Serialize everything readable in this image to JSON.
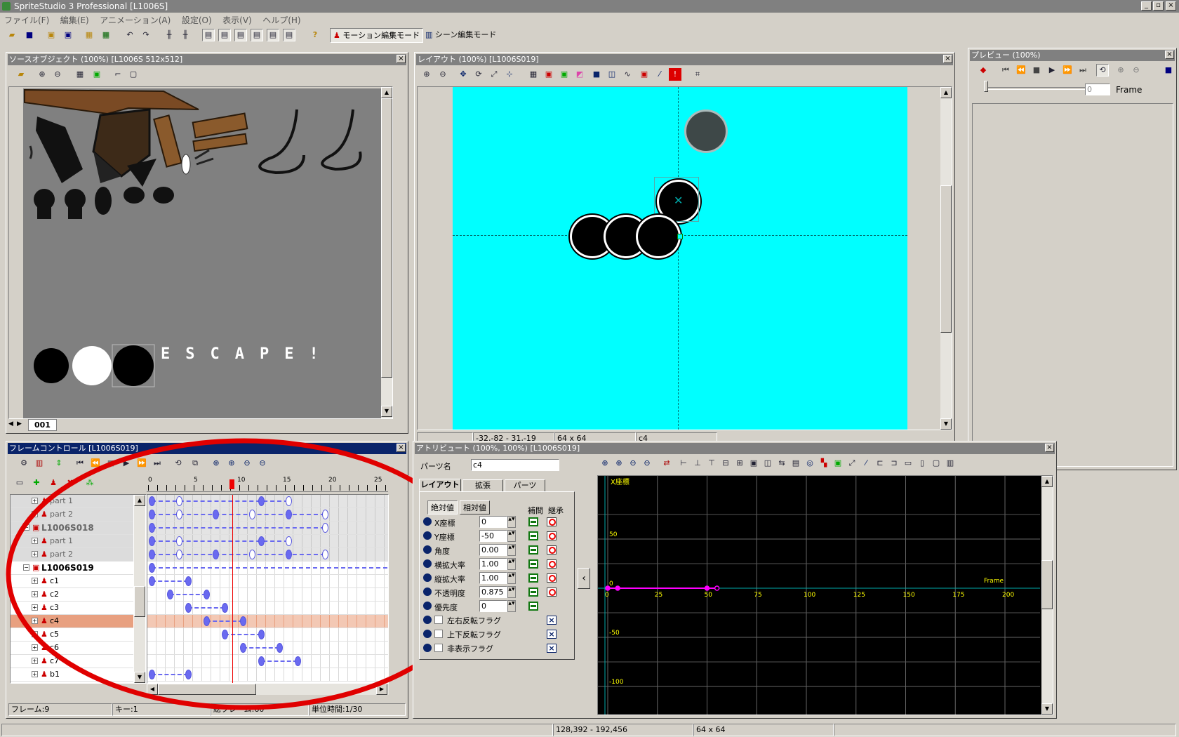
{
  "app": {
    "title": "SpriteStudio 3 Professional [L1006S]",
    "menus": [
      "ファイル(F)",
      "編集(E)",
      "アニメーション(A)",
      "設定(O)",
      "表示(V)",
      "ヘルプ(H)"
    ],
    "modes": {
      "motion": "モーション編集モード",
      "scene": "シーン編集モード"
    }
  },
  "source_panel": {
    "title": "ソースオブジェクト (100%) [L1006S  512x512]",
    "sheet_tab": "001",
    "sprite_text": "ESCAPE!"
  },
  "layout_panel": {
    "title": "レイアウト (100%) [L1006S019]",
    "status_coords": "-32,-82 - 31,-19",
    "status_size": "64 x 64",
    "status_part": "c4",
    "canvas_color": "#00ffff"
  },
  "preview_panel": {
    "title": "プレビュー (100%)",
    "frame_value": "0",
    "frame_label": "Frame"
  },
  "frame_panel": {
    "title": "フレームコントロール [L1006S019]",
    "ruler": [
      "0",
      "5",
      "10",
      "15",
      "20",
      "25"
    ],
    "current_frame": 9,
    "tree": [
      {
        "label": "part 1",
        "type": "part",
        "grey": true
      },
      {
        "label": "part 2",
        "type": "part",
        "grey": true
      },
      {
        "label": "L1006S018",
        "type": "group",
        "grey": true
      },
      {
        "label": "part 1",
        "type": "part",
        "grey": true
      },
      {
        "label": "part 2",
        "type": "part",
        "grey": true
      },
      {
        "label": "L1006S019",
        "type": "group",
        "grey": false
      },
      {
        "label": "c1",
        "type": "part",
        "grey": false
      },
      {
        "label": "c2",
        "type": "part",
        "grey": false
      },
      {
        "label": "c3",
        "type": "part",
        "grey": false
      },
      {
        "label": "c4",
        "type": "part",
        "grey": false,
        "selected": true
      },
      {
        "label": "c5",
        "type": "part",
        "grey": false
      },
      {
        "label": "c6",
        "type": "part",
        "grey": false
      },
      {
        "label": "c7",
        "type": "part",
        "grey": false
      },
      {
        "label": "b1",
        "type": "part",
        "grey": false
      }
    ],
    "status": {
      "frame": "フレーム:9",
      "key": "キー:1",
      "total": "総フレーム:60",
      "unit": "単位時間:1/30"
    }
  },
  "attr_panel": {
    "title": "アトリビュート (100%, 100%) [L1006S019]",
    "part_name_label": "パーツ名",
    "part_name": "c4",
    "tabs": [
      "レイアウト",
      "拡張",
      "パーツ"
    ],
    "abs_label": "絶対値",
    "rel_label": "相対値",
    "interp_label": "補間",
    "inherit_label": "継承",
    "fields": [
      {
        "label": "X座標",
        "value": "0"
      },
      {
        "label": "Y座標",
        "value": "-50"
      },
      {
        "label": "角度",
        "value": "0.00"
      },
      {
        "label": "横拡大率",
        "value": "1.00"
      },
      {
        "label": "縦拡大率",
        "value": "1.00"
      },
      {
        "label": "不透明度",
        "value": "0.875"
      },
      {
        "label": "優先度",
        "value": "0"
      }
    ],
    "flags": [
      "左右反転フラグ",
      "上下反転フラグ",
      "非表示フラグ"
    ]
  },
  "graph_panel": {
    "series_label": "X座標",
    "y_ticks": [
      "50",
      "0",
      "-50",
      "-100"
    ],
    "x_ticks": [
      "0",
      "25",
      "50",
      "75",
      "100",
      "125",
      "150",
      "175",
      "200"
    ],
    "x_axis_label": "Frame",
    "keys_frames": [
      0,
      5,
      50,
      55
    ],
    "key_values": [
      0,
      0,
      0,
      0
    ]
  },
  "statusbar": {
    "coords": "128,392 - 192,456",
    "size": "64 x 64"
  }
}
